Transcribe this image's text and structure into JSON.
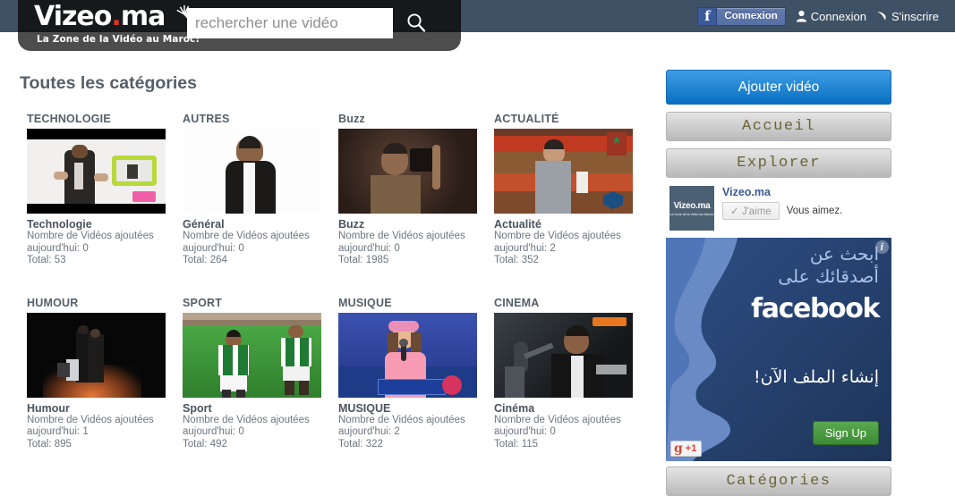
{
  "site": {
    "logo_main": "Vizeo",
    "logo_dot": ".",
    "logo_suffix": "ma",
    "tagline": "La Zone de la Vidéo au Maroc!"
  },
  "search": {
    "placeholder": "rechercher une vidéo",
    "value": "",
    "icon": "search-icon"
  },
  "header_links": {
    "fb_connect": "Connexion",
    "login": "Connexion",
    "signup": "S'inscrire",
    "user_icon": "user-icon",
    "pen_icon": "pen-icon",
    "fb_icon": "facebook-f-icon"
  },
  "main": {
    "title": "Toutes les catégories",
    "stat_label": "Nombre de Vidéos ajoutées",
    "today_label": "aujourd'hui:",
    "total_label": "Total:"
  },
  "categories": [
    [
      {
        "header": "TECHNOLOGIE",
        "name": "Technologie",
        "today": "0",
        "total": "53",
        "thumb": "technologie"
      },
      {
        "header": "AUTRES",
        "name": "Général",
        "today": "0",
        "total": "264",
        "thumb": "autres"
      },
      {
        "header": "Buzz",
        "name": "Buzz",
        "today": "0",
        "total": "1985",
        "thumb": "buzz"
      },
      {
        "header": "ACTUALITÉ",
        "name": "Actualité",
        "today": "2",
        "total": "352",
        "thumb": "actualite"
      }
    ],
    [
      {
        "header": "HUMOUR",
        "name": "Humour",
        "today": "1",
        "total": "895",
        "thumb": "humour"
      },
      {
        "header": "SPORT",
        "name": "Sport",
        "today": "0",
        "total": "492",
        "thumb": "sport"
      },
      {
        "header": "MUSIQUE",
        "name": "MUSIQUE",
        "today": "2",
        "total": "322",
        "thumb": "musique"
      },
      {
        "header": "CINEMA",
        "name": "Cinéma",
        "today": "0",
        "total": "115",
        "thumb": "cinema"
      }
    ]
  ],
  "sidebar": {
    "add_video": "Ajouter vidéo",
    "home": "Accueil",
    "explore": "Explorer",
    "categories_footer": "Catégories"
  },
  "likebox": {
    "page_name": "Vizeo.ma",
    "avatar_title": "Vizeo.ma",
    "avatar_sub": "La Zone de la Vidéo au Maroc!",
    "like_button": "✓ J'aime",
    "status": "Vous aimez."
  },
  "ad": {
    "info_glyph": "i",
    "arabic_line1": "ابحث عن",
    "arabic_line2": "أصدقائك على",
    "brand": "facebook",
    "arabic_cta": "إنشاء الملف الآن!",
    "signup": "Sign Up",
    "gplus_g": "g",
    "gplus_plus": "+1"
  },
  "colors": {
    "header_bg": "#3f5164",
    "logo_bg": "#15191c",
    "tagbar_bg": "#4d4d4d",
    "accent_blue": "#0a6fc2",
    "fb_blue": "#3b5998",
    "nav_text": "#6b6338",
    "title_text": "#555f68",
    "logo_dot_red": "#d8342a"
  }
}
